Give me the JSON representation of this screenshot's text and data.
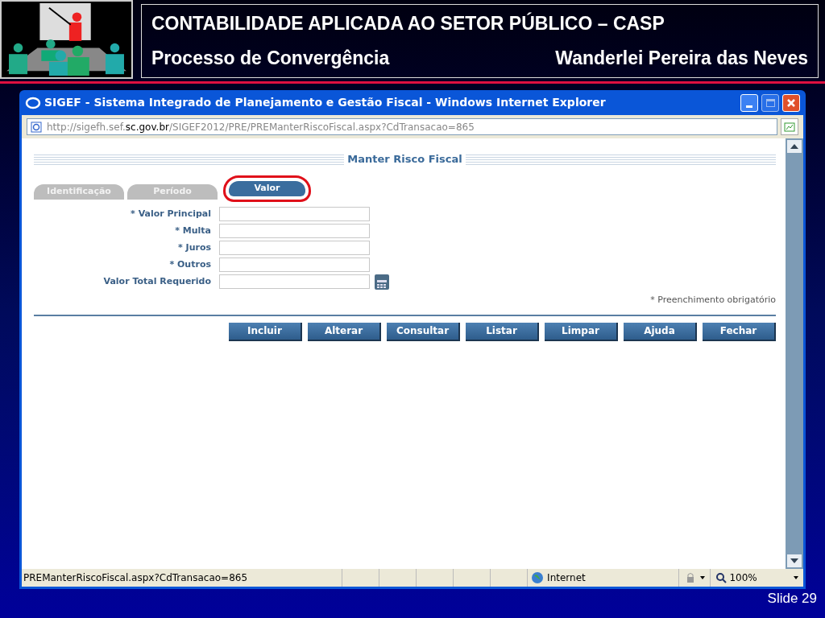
{
  "slide": {
    "title": "CONTABILIDADE APLICADA  AO SETOR PÚBLICO – CASP",
    "subtitle": "Processo de Convergência",
    "author": "Wanderlei Pereira das Neves",
    "slide_number": "Slide 29"
  },
  "window": {
    "title": "SIGEF - Sistema Integrado de Planejamento e Gestão Fiscal - Windows Internet Explorer"
  },
  "address": {
    "prefix": "http://sigefh.sef.",
    "domain": "sc.gov.br",
    "path": "/SIGEF2012/PRE/PREManterRiscoFiscal.aspx?CdTransacao=865"
  },
  "page": {
    "heading": "Manter Risco Fiscal",
    "tabs": [
      {
        "label": "Identificação",
        "selected": false,
        "highlighted": false
      },
      {
        "label": "Período",
        "selected": false,
        "highlighted": false
      },
      {
        "label": "Valor",
        "selected": true,
        "highlighted": true
      }
    ],
    "fields": [
      {
        "label": "* Valor Principal",
        "calculator": false
      },
      {
        "label": "* Multa",
        "calculator": false
      },
      {
        "label": "* Juros",
        "calculator": false
      },
      {
        "label": "* Outros",
        "calculator": false
      },
      {
        "label": "Valor Total Requerido",
        "calculator": true
      }
    ],
    "note": "* Preenchimento obrigatório",
    "buttons": [
      "Incluir",
      "Alterar",
      "Consultar",
      "Listar",
      "Limpar",
      "Ajuda",
      "Fechar"
    ]
  },
  "status_bar": {
    "url": "PREManterRiscoFiscal.aspx?CdTransacao=865",
    "zone": "Internet",
    "zoom": "100%"
  }
}
